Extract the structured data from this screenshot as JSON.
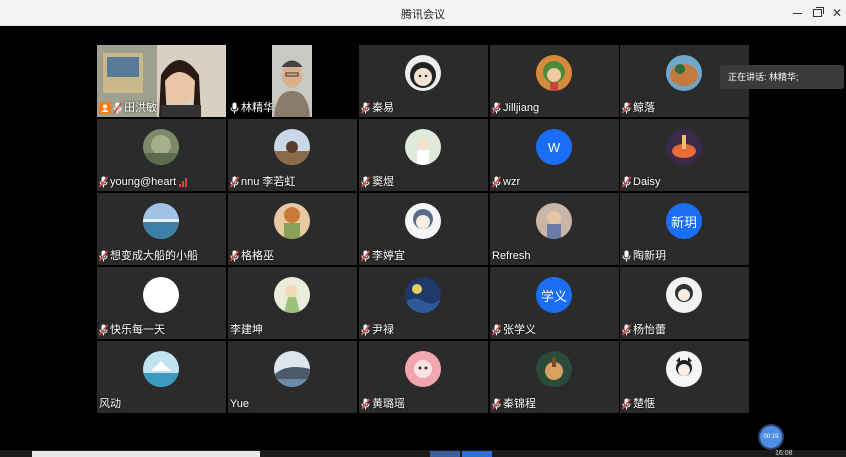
{
  "window": {
    "title": "腾讯会议",
    "controls": [
      "minimize-icon",
      "restore-icon",
      "close-icon"
    ]
  },
  "speaking_toast": "正在讲话: 林精华;",
  "timer_bubble": "00:19",
  "accent_colors": {
    "mic_muted": "#e04a4a",
    "speaking_border": "#2a9a4a",
    "letter_avatar": "#1a6ef5",
    "host_badge": "#f07d1a"
  },
  "participants": [
    {
      "name": "田洪敏",
      "mic": "muted",
      "host": true,
      "video": true
    },
    {
      "name": "林精华",
      "mic": "on",
      "video": true,
      "speaking": true
    },
    {
      "name": "秦易",
      "mic": "muted"
    },
    {
      "name": "Jilljiang",
      "mic": "muted"
    },
    {
      "name": "鲸落",
      "mic": "muted"
    },
    {
      "name": "young@heart",
      "mic": "muted",
      "signal": true
    },
    {
      "name": "nnu 李若虹",
      "mic": "muted"
    },
    {
      "name": "窦煜",
      "mic": "muted"
    },
    {
      "name": "wzr",
      "mic": "muted",
      "avatar_letter": "W"
    },
    {
      "name": "Daisy",
      "mic": "muted"
    },
    {
      "name": "想变成大船的小船",
      "mic": "muted"
    },
    {
      "name": "格格巫",
      "mic": "muted"
    },
    {
      "name": "李婷宜",
      "mic": "muted"
    },
    {
      "name": "Refresh",
      "mic": "none"
    },
    {
      "name": "陶新玥",
      "mic": "on",
      "avatar_letter": "新玥"
    },
    {
      "name": "快乐每一天",
      "mic": "muted"
    },
    {
      "name": "李建坤",
      "mic": "none"
    },
    {
      "name": "尹禄",
      "mic": "muted"
    },
    {
      "name": "张学义",
      "mic": "muted",
      "avatar_letter": "学义"
    },
    {
      "name": "杨怡蕾",
      "mic": "muted"
    },
    {
      "name": "风动",
      "mic": "none"
    },
    {
      "name": "Yue",
      "mic": "none"
    },
    {
      "name": "黄璐瑶",
      "mic": "muted"
    },
    {
      "name": "秦锦程",
      "mic": "muted"
    },
    {
      "name": "楚惬",
      "mic": "muted"
    }
  ],
  "taskbar": {
    "clock": "16:08"
  }
}
